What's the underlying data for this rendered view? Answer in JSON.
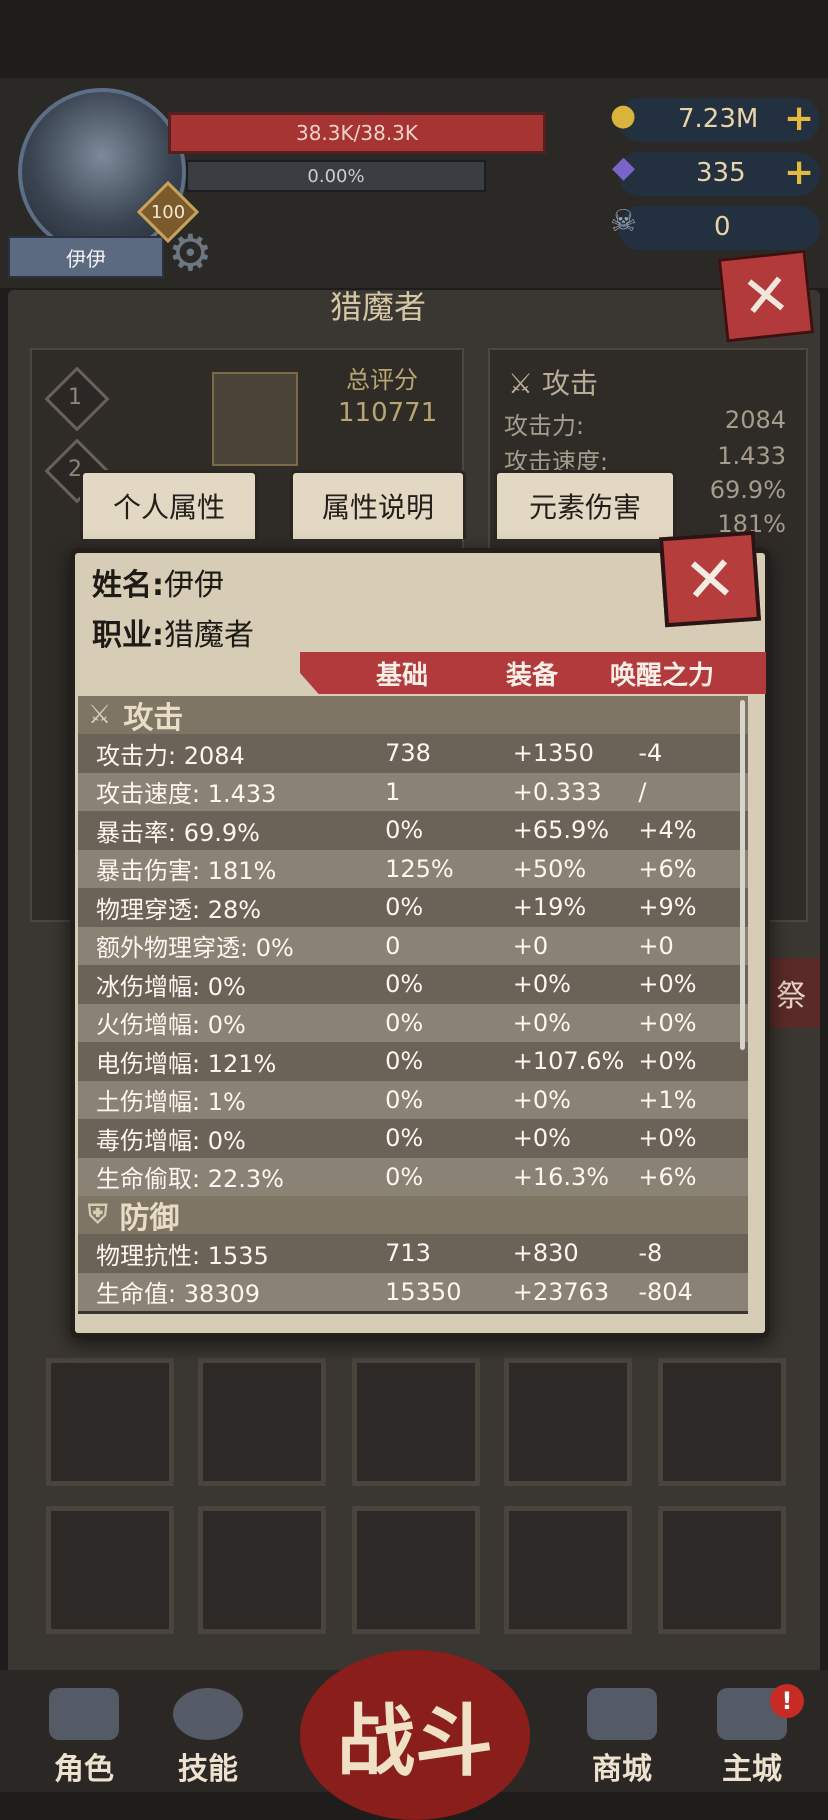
{
  "player": {
    "name": "伊伊",
    "level": "100",
    "hp": "38.3K/38.3K",
    "exp": "0.00%"
  },
  "currency": [
    {
      "icon": "gold-coin-icon",
      "value": "7.23M",
      "has_plus": true
    },
    {
      "icon": "purple-gem-icon",
      "value": "335",
      "has_plus": true
    },
    {
      "icon": "horn-skull-icon",
      "value": "0",
      "has_plus": false
    }
  ],
  "background": {
    "title": "猎魔者",
    "score_label": "总评分",
    "score_value": "110771",
    "slot_labels": [
      "1",
      "2"
    ],
    "tabs": [
      "个人属性",
      "属性说明",
      "元素伤害"
    ],
    "right_title": "攻击",
    "right_rows": [
      {
        "label": "攻击力:",
        "value": "2084"
      },
      {
        "label": "攻击速度:",
        "value": "1.433"
      },
      {
        "label": "",
        "value": "69.9%"
      },
      {
        "label": "",
        "value": "181%"
      }
    ],
    "side_text": "祭"
  },
  "modal": {
    "name_label": "姓名:",
    "name_value": "伊伊",
    "class_label": "职业:",
    "class_value": "猎魔者",
    "columns": [
      "基础",
      "装备",
      "唤醒之力"
    ],
    "sections": [
      {
        "title": "攻击",
        "icon": "crossed-swords-icon",
        "rows": [
          {
            "label": "攻击力: 2084",
            "base": "738",
            "equip": "+1350",
            "awaken": "-4"
          },
          {
            "label": "攻击速度: 1.433",
            "base": "1",
            "equip": "+0.333",
            "awaken": "/"
          },
          {
            "label": "暴击率: 69.9%",
            "base": "0%",
            "equip": "+65.9%",
            "awaken": "+4%"
          },
          {
            "label": "暴击伤害: 181%",
            "base": "125%",
            "equip": "+50%",
            "awaken": "+6%"
          },
          {
            "label": "物理穿透: 28%",
            "base": "0%",
            "equip": "+19%",
            "awaken": "+9%"
          },
          {
            "label": "额外物理穿透: 0%",
            "base": "0",
            "equip": "+0",
            "awaken": "+0"
          },
          {
            "label": "冰伤增幅: 0%",
            "base": "0%",
            "equip": "+0%",
            "awaken": "+0%"
          },
          {
            "label": "火伤增幅: 0%",
            "base": "0%",
            "equip": "+0%",
            "awaken": "+0%"
          },
          {
            "label": "电伤增幅: 121%",
            "base": "0%",
            "equip": "+107.6%",
            "awaken": "+0%"
          },
          {
            "label": "土伤增幅: 1%",
            "base": "0%",
            "equip": "+0%",
            "awaken": "+1%"
          },
          {
            "label": "毒伤增幅: 0%",
            "base": "0%",
            "equip": "+0%",
            "awaken": "+0%"
          },
          {
            "label": "生命偷取: 22.3%",
            "base": "0%",
            "equip": "+16.3%",
            "awaken": "+6%"
          }
        ]
      },
      {
        "title": "防御",
        "icon": "shield-icon",
        "rows": [
          {
            "label": "物理抗性: 1535",
            "base": "713",
            "equip": "+830",
            "awaken": "-8"
          },
          {
            "label": "生命值: 38309",
            "base": "15350",
            "equip": "+23763",
            "awaken": "-804"
          }
        ]
      }
    ]
  },
  "nav": {
    "items": [
      "角色",
      "技能",
      "商城",
      "主城"
    ],
    "battle": "战斗",
    "badge": "!"
  },
  "colors": {
    "accent_red": "#b23a3c",
    "panel": "#d7cdb7",
    "row_dark": "#6b6358",
    "row_light": "#8a8274"
  }
}
